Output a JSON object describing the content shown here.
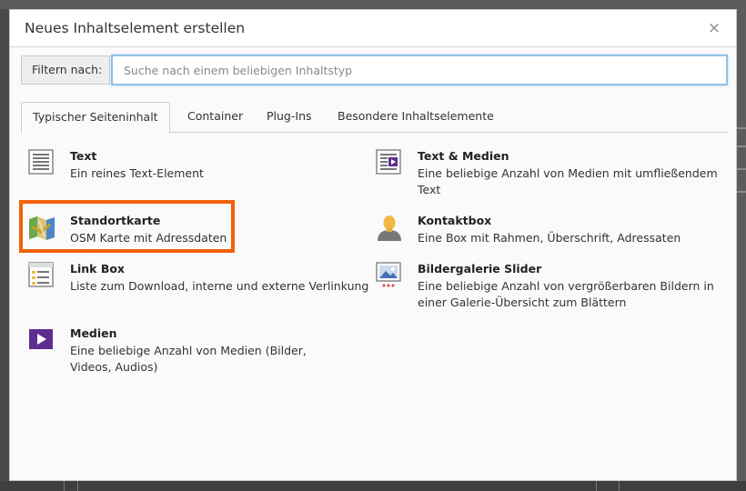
{
  "dialog": {
    "title": "Neues Inhaltselement erstellen",
    "close_glyph": "×"
  },
  "filter": {
    "label": "Filtern nach:",
    "value": "",
    "placeholder": "Suche nach einem beliebigen Inhaltstyp"
  },
  "tabs": [
    {
      "label": "Typischer Seiteninhalt",
      "active": true
    },
    {
      "label": "Container",
      "active": false
    },
    {
      "label": "Plug-Ins",
      "active": false
    },
    {
      "label": "Besondere Inhaltselemente",
      "active": false
    }
  ],
  "items": [
    {
      "name": "Text",
      "desc": "Ein reines Text-Element",
      "icon": "text-icon"
    },
    {
      "name": "Text & Medien",
      "desc": "Eine beliebige Anzahl von Medien mit umfließendem Text",
      "icon": "text-media-icon"
    },
    {
      "name": "Standortkarte",
      "desc": "OSM Karte mit Adressdaten",
      "icon": "map-icon"
    },
    {
      "name": "Kontaktbox",
      "desc": "Eine Box mit Rahmen, Überschrift, Adressaten",
      "icon": "contact-person-icon"
    },
    {
      "name": "Link Box",
      "desc": "Liste zum Download, interne und externe Verlinkung",
      "icon": "link-list-icon"
    },
    {
      "name": "Bildergalerie Slider",
      "desc": "Eine beliebige Anzahl von vergrößerbaren Bildern in einer Galerie-Übersicht zum Blättern",
      "icon": "gallery-slider-icon"
    },
    {
      "name": "Medien",
      "desc": "Eine beliebige Anzahl von Medien (Bilder, Videos, Audios)",
      "icon": "media-play-icon"
    }
  ],
  "colors": {
    "highlight": "#f0620a",
    "input_focus": "#8fc0e8",
    "media_purple": "#5f2d8f"
  }
}
